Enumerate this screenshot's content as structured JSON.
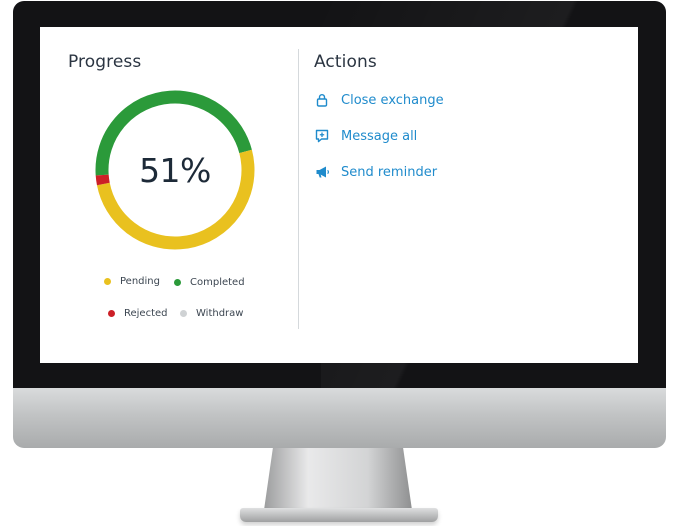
{
  "progress": {
    "title": "Progress",
    "percent_label": "51%",
    "segments": [
      {
        "name": "Completed",
        "fraction": 0.47,
        "color": "#2b9a3a"
      },
      {
        "name": "Pending",
        "fraction": 0.51,
        "color": "#e9c11f"
      },
      {
        "name": "Rejected",
        "fraction": 0.02,
        "color": "#cc2027"
      }
    ],
    "legend": [
      {
        "label": "Pending",
        "color": "#e9c11f"
      },
      {
        "label": "Completed",
        "color": "#2b9a3a"
      },
      {
        "label": "Rejected",
        "color": "#cc2027"
      },
      {
        "label": "Withdraw",
        "color": "#cfd2d4"
      }
    ]
  },
  "actions": {
    "title": "Actions",
    "items": [
      {
        "label": "Close exchange",
        "icon": "lock-icon"
      },
      {
        "label": "Message all",
        "icon": "message-plus-icon"
      },
      {
        "label": "Send reminder",
        "icon": "megaphone-icon"
      }
    ]
  },
  "colors": {
    "link": "#1f8bcc",
    "text": "#2b3542",
    "divider": "#d5d9dc"
  }
}
